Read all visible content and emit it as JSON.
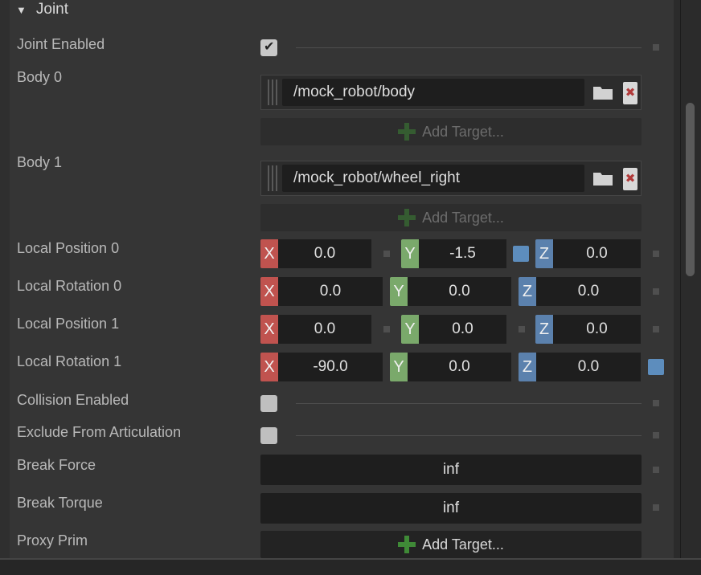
{
  "section": {
    "title": "Joint"
  },
  "rows": {
    "joint_enabled": {
      "label": "Joint Enabled",
      "checked": true
    },
    "body0": {
      "label": "Body 0",
      "path": "/mock_robot/body",
      "add_label": "Add Target..."
    },
    "body1": {
      "label": "Body 1",
      "path": "/mock_robot/wheel_right",
      "add_label": "Add Target..."
    },
    "local_position_0": {
      "label": "Local Position 0",
      "x": "0.0",
      "y": "-1.5",
      "z": "0.0"
    },
    "local_rotation_0": {
      "label": "Local Rotation 0",
      "x": "0.0",
      "y": "0.0",
      "z": "0.0"
    },
    "local_position_1": {
      "label": "Local Position 1",
      "x": "0.0",
      "y": "0.0",
      "z": "0.0"
    },
    "local_rotation_1": {
      "label": "Local Rotation 1",
      "x": "-90.0",
      "y": "0.0",
      "z": "0.0"
    },
    "collision_enabled": {
      "label": "Collision Enabled",
      "checked": false
    },
    "exclude_from_articulation": {
      "label": "Exclude From Articulation",
      "checked": false
    },
    "break_force": {
      "label": "Break Force",
      "value": "inf"
    },
    "break_torque": {
      "label": "Break Torque",
      "value": "inf"
    },
    "proxy_prim": {
      "label": "Proxy Prim",
      "add_label": "Add Target..."
    }
  },
  "axis_labels": {
    "x": "X",
    "y": "Y",
    "z": "Z"
  },
  "icons": {
    "collapse": "triangle-down-icon",
    "check": "checkmark-icon",
    "folder": "folder-icon",
    "remove": "close-icon",
    "add": "plus-icon",
    "grip": "drag-handle-icon"
  },
  "glyphs": {
    "tri": "▼",
    "check": "✔",
    "remove": "✖"
  },
  "colors": {
    "panel": "#353535",
    "axis_x": "#c0534f",
    "axis_y": "#7aa96b",
    "axis_z": "#5b81ad",
    "add_green": "#3f8a37",
    "field": "#1e1e1e"
  }
}
